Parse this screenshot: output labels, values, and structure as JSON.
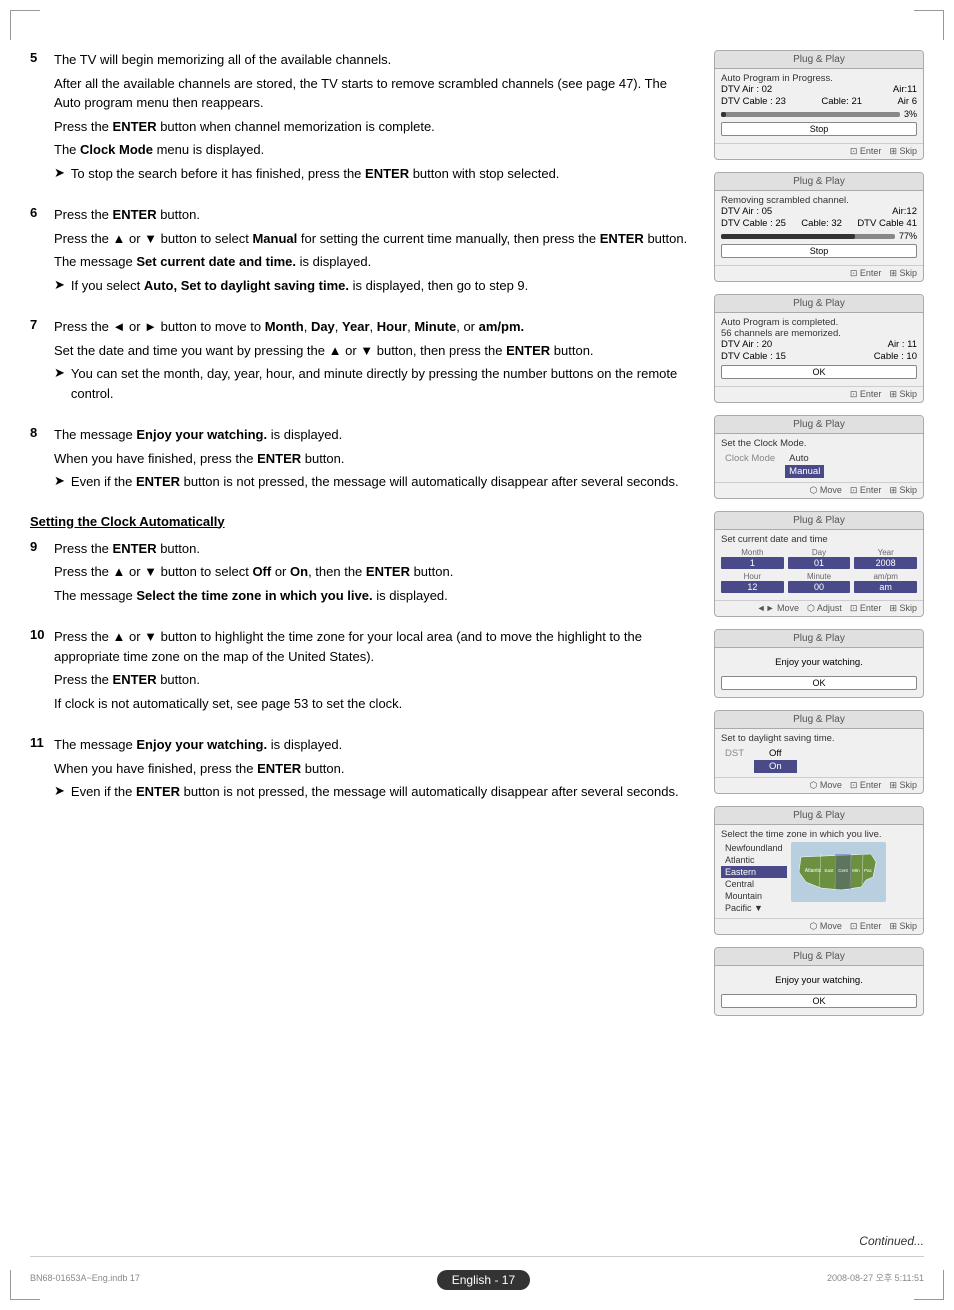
{
  "page": {
    "corner_marks": true
  },
  "steps": [
    {
      "number": "5",
      "paragraphs": [
        "The TV will begin memorizing all of the available channels.",
        "After all the available channels are stored, the TV starts to remove scrambled channels (see page 47). The Auto program menu then reappears.",
        "Press the ENTER button when channel memorization is complete.",
        "The Clock Mode menu is displayed."
      ],
      "bold_words": [
        "ENTER",
        "Clock Mode"
      ],
      "note": {
        "arrow": "➤",
        "text": "To stop the search before it has finished, press the ENTER button with stop selected.",
        "bold": [
          "ENTER"
        ]
      }
    },
    {
      "number": "6",
      "paragraphs": [
        "Press the ENTER button.",
        "Press the ▲ or ▼ button to select Manual for setting the current time manually, then press the ENTER button.",
        "The message Set current date and time. is displayed.",
        "If you select Auto, Set to daylight saving time. is displayed, then go to step 9."
      ],
      "bold_words": [
        "ENTER",
        "Manual",
        "ENTER",
        "Set current date and time.",
        "Auto,",
        "Set to daylight saving time."
      ],
      "note": {
        "arrow": "➤",
        "text": "If you select Auto, Set to daylight saving time. is displayed, then go to step 9."
      }
    },
    {
      "number": "7",
      "paragraphs": [
        "Press the ◄ or ► button to move to Month, Day, Year, Hour, Minute, or am/pm.",
        "Set the date and time you want by pressing the ▲ or ▼ button, then press the ENTER button."
      ],
      "bold_words": [
        "Month",
        "Day",
        "Year",
        "Hour",
        "Minute",
        "am/pm.",
        "ENTER"
      ],
      "note": {
        "arrow": "➤",
        "text": "You can set the month, day, year, hour, and minute directly by pressing the number buttons on the remote control."
      }
    },
    {
      "number": "8",
      "paragraphs": [
        "The message Enjoy your watching. is displayed.",
        "When you have finished, press the ENTER button."
      ],
      "bold_words": [
        "Enjoy your watching.",
        "ENTER"
      ],
      "note": {
        "arrow": "➤",
        "text": "Even if the ENTER button is not pressed, the message will automatically disappear after several seconds.",
        "bold": [
          "ENTER"
        ]
      }
    }
  ],
  "section_heading": "Setting the Clock Automatically",
  "steps_auto": [
    {
      "number": "9",
      "paragraphs": [
        "Press the ENTER button.",
        "Press the ▲ or ▼ button to select Off or On, then the ENTER button.",
        "The message Select the time zone in which you live. is displayed."
      ],
      "bold_words": [
        "ENTER",
        "Off",
        "On",
        "ENTER",
        "Select the time zone in which you live."
      ]
    },
    {
      "number": "10",
      "paragraphs": [
        "Press the ▲ or ▼ button to highlight the time zone for your local area (and to move the highlight to the appropriate time zone on the map of the United States).",
        "Press the ENTER button.",
        "If clock is not automatically set, see page 53 to set the clock."
      ],
      "bold_words": [
        "ENTER"
      ]
    },
    {
      "number": "11",
      "paragraphs": [
        "The message Enjoy your watching. is displayed.",
        "When you have finished, press the ENTER button."
      ],
      "bold_words": [
        "Enjoy your watching.",
        "ENTER"
      ],
      "note": {
        "arrow": "➤",
        "text": "Even if the ENTER button is not pressed, the message will automatically disappear after several seconds.",
        "bold": [
          "ENTER"
        ]
      }
    }
  ],
  "continued_text": "Continued...",
  "page_number_label": "English - 17",
  "footer_file": "BN68-01653A~Eng.indb   17",
  "footer_date": "2008-08-27   오후 5:11:51",
  "panels": {
    "panel1": {
      "title": "Plug & Play",
      "line1": "Auto Program in Progress.",
      "line2_label": "DTV Air : 02",
      "line2_val": "Air:11",
      "line3_label": "DTV Cable : 23",
      "line3_val": "Cable: 21",
      "line4_right": "Air 6",
      "progress_pct": 3,
      "progress_text": "3%",
      "btn": "Stop",
      "footer_enter": "⊡ Enter",
      "footer_skip": "⊞ Skip"
    },
    "panel2": {
      "title": "Plug & Play",
      "line1": "Removing scrambled channel.",
      "line2_label": "DTV Air : 05",
      "line2_val": "Air:12",
      "line3_label": "DTV Cable : 25",
      "line3_val": "Cable: 32",
      "line4_right": "DTV Cable 41",
      "progress_pct": 77,
      "progress_text": "77%",
      "btn": "Stop",
      "footer_enter": "⊡ Enter",
      "footer_skip": "⊞ Skip"
    },
    "panel3": {
      "title": "Plug & Play",
      "line1": "Auto Program is completed.",
      "line2": "56 channels are memorized.",
      "line3_label": "DTV Air : 20",
      "line3_val": "Air : 11",
      "line4_label": "DTV Cable : 15",
      "line4_val": "Cable : 10",
      "btn": "OK",
      "footer_enter": "⊡ Enter",
      "footer_skip": "⊞ Skip"
    },
    "panel4": {
      "title": "Plug & Play",
      "line1": "Set the Clock Mode.",
      "label": "Clock Mode",
      "option_auto": "Auto",
      "option_manual": "Manual",
      "footer_move": "⬡ Move",
      "footer_enter": "⊡ Enter",
      "footer_skip": "⊞ Skip"
    },
    "panel5": {
      "title": "Plug & Play",
      "line1": "Set current date and time",
      "fields": {
        "month_label": "Month",
        "month_val": "1",
        "day_label": "Day",
        "day_val": "01",
        "year_label": "Year",
        "year_val": "2008",
        "hour_label": "Hour",
        "hour_val": "12",
        "minute_label": "Minute",
        "minute_val": "00",
        "ampm_label": "am/pm",
        "ampm_val": "am"
      },
      "footer_move": "◄► Move",
      "footer_adjust": "⬡ Adjust",
      "footer_enter": "⊡ Enter",
      "footer_skip": "⊞ Skip"
    },
    "panel6": {
      "title": "Plug & Play",
      "line1": "Enjoy your watching.",
      "btn": "OK"
    },
    "panel7": {
      "title": "Plug & Play",
      "line1": "Set to daylight saving time.",
      "label": "DST",
      "option_off": "Off",
      "option_on": "On",
      "footer_move": "⬡ Move",
      "footer_enter": "⊡ Enter",
      "footer_skip": "⊞ Skip"
    },
    "panel8": {
      "title": "Plug & Play",
      "line1": "Select the time zone in which you live.",
      "zones": [
        "Newfoundland",
        "Atlantic",
        "Eastern",
        "Central",
        "Mountain",
        "Pacific"
      ],
      "selected_zone": "Eastern",
      "footer_move": "⬡ Move",
      "footer_enter": "⊡ Enter",
      "footer_skip": "⊞ Skip"
    },
    "panel9": {
      "title": "Plug & Play",
      "line1": "Enjoy your watching.",
      "btn": "OK"
    }
  }
}
